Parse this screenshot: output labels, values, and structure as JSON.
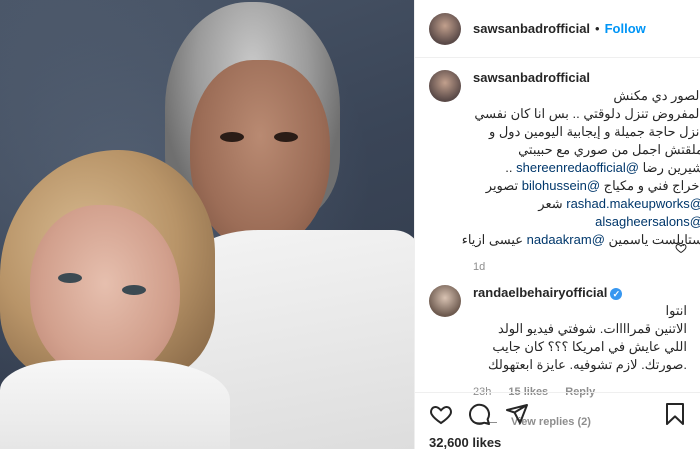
{
  "header": {
    "username": "sawsanbadrofficial",
    "follow_label": "Follow",
    "separator": "•"
  },
  "caption": {
    "username": "sawsanbadrofficial",
    "line1": "الصور دي مكنش",
    "line2": "المفروض تنزل دلوقتي .. بس انا كان نفسي",
    "line3": "انزل حاجة جميلة و إيجابية اليومين دول و",
    "line4": "ملقتش اجمل من صوري مع حبيبتي",
    "line5_text": "شيرين رضا",
    "line5_mention": "@shereenredaofficial",
    "line5_tail": "..",
    "line6_text": "اخراج فني و مكياج",
    "line6_mention": "@bilohussein",
    "line6_tail": "تصوير",
    "line7_mention": "@rashad.makeupworks",
    "line7_tail": "شعر",
    "line8_mention": "@alsagheersalons",
    "line9_text": "ستايلست ياسمين",
    "line9_mention": "@nadaakram",
    "line9_tail": "عيسى ازياء",
    "time": "1d"
  },
  "reply": {
    "username": "randaelbehairyofficial",
    "verified": "✓",
    "line1": "انتوا",
    "line2": "الاتنين قمراااات. شوفتي فيديو الولد",
    "line3": "اللي عايش في امريكا ؟؟؟ كان جايب",
    "line4": ".صورتك. لازم تشوفيه. عايزة ابعتهولك",
    "time": "23h",
    "likes": "15 likes",
    "reply_label": "Reply",
    "view_replies": "View replies (2)"
  },
  "footer": {
    "likes": "32,600 likes"
  },
  "icons": {
    "like": "heart-icon",
    "comment": "comment-icon",
    "share": "share-icon",
    "save": "bookmark-icon"
  }
}
